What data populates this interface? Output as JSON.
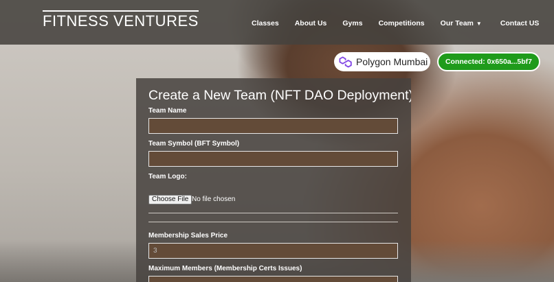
{
  "header": {
    "brand": "FITNESS VENTURES",
    "nav": [
      {
        "label": "Classes"
      },
      {
        "label": "About Us"
      },
      {
        "label": "Gyms"
      },
      {
        "label": "Competitions"
      },
      {
        "label": "Our Team",
        "has_dropdown": true
      },
      {
        "label": "Contact US"
      }
    ]
  },
  "network": {
    "label": "Polygon Mumbai",
    "icon": "polygon-logo-icon",
    "icon_color": "#8247e5"
  },
  "wallet": {
    "label": "Connected: 0x650a...5bf7",
    "color": "#1f9b1b"
  },
  "form": {
    "title": "Create a New Team (NFT DAO Deployment)",
    "team_name_label": "Team Name",
    "team_name_value": "",
    "team_symbol_label": "Team Symbol (BFT Symbol)",
    "team_symbol_value": "",
    "team_logo_label": "Team Logo:",
    "file_button": "Choose File",
    "file_status": "No file chosen",
    "price_label": "Membership Sales Price",
    "price_placeholder": "3",
    "max_members_label": "Maximum Members (Membership Certs Issues)",
    "max_members_value": ""
  },
  "colors": {
    "input_bg": "#634b38",
    "card_bg": "#46423e"
  }
}
